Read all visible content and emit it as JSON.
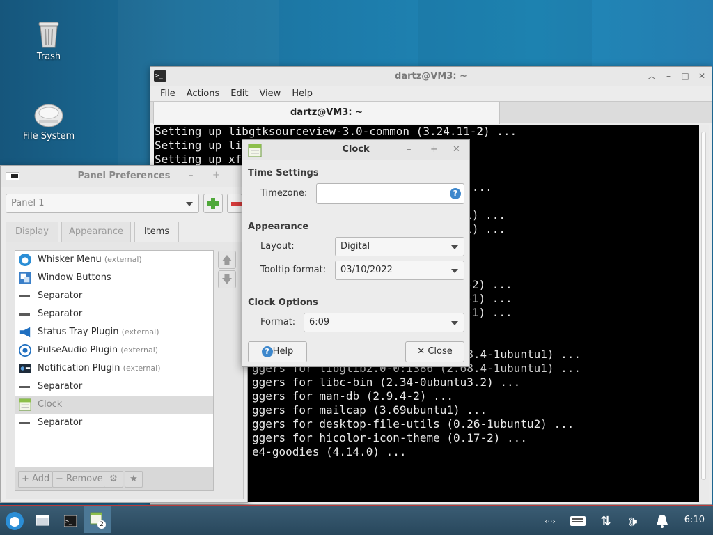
{
  "desktop": {
    "icons": [
      {
        "label": "Trash",
        "icon": "trash-icon"
      },
      {
        "label": "File System",
        "icon": "drive-icon"
      }
    ]
  },
  "terminal": {
    "title": "dartz@VM3: ~",
    "tab_title": "dartz@VM3: ~",
    "menu": [
      "File",
      "Actions",
      "Edit",
      "View",
      "Help"
    ],
    "lines": [
      "Setting up libgtksourceview-3.0-common (3.24.11-2) ...",
      "Setting up li",
      "Setting up xf",
      "",
      "              ...",
      "",
      "             1) ...",
      "             1) ...",
      "",
      "",
      "",
      "          .11-2) ...",
      "            0-1) ...",
      "            2-1) ...",
      "",
      "",
      "ggers for libglib2.0-0:i386 (2.68.4-1ubuntu1) ...",
      "ggers for libglib2.0-0:i386 (2.68.4-1ubuntu1) ...",
      "ggers for libc-bin (2.34-0ubuntu3.2) ...",
      "ggers for man-db (2.9.4-2) ...",
      "ggers for mailcap (3.69ubuntu1) ...",
      "ggers for desktop-file-utils (0.26-1ubuntu2) ...",
      "ggers for hicolor-icon-theme (0.17-2) ...",
      "e4-goodies (4.14.0) ..."
    ]
  },
  "prefs": {
    "title": "Panel Preferences",
    "panel_select": "Panel 1",
    "tabs": [
      "Display",
      "Appearance",
      "Items"
    ],
    "items": [
      {
        "name": "Whisker Menu",
        "ext": "(external)",
        "icon": "whisker-menu-icon"
      },
      {
        "name": "Window Buttons",
        "ext": "",
        "icon": "window-buttons-icon"
      },
      {
        "name": "Separator",
        "ext": "",
        "icon": "separator-icon"
      },
      {
        "name": "Separator",
        "ext": "",
        "icon": "separator-icon"
      },
      {
        "name": "Status Tray Plugin",
        "ext": "(external)",
        "icon": "megaphone-icon"
      },
      {
        "name": "PulseAudio Plugin",
        "ext": "(external)",
        "icon": "speaker-icon"
      },
      {
        "name": "Notification Plugin",
        "ext": "(external)",
        "icon": "notification-icon"
      },
      {
        "name": "Separator",
        "ext": "",
        "icon": "separator-icon"
      },
      {
        "name": "Clock",
        "ext": "",
        "icon": "clock-icon"
      },
      {
        "name": "Separator",
        "ext": "",
        "icon": "separator-icon"
      }
    ],
    "add_label": "Add",
    "remove_label": "Remove",
    "close_label": "Close"
  },
  "clock": {
    "title": "Clock",
    "time_settings": "Time Settings",
    "timezone_label": "Timezone:",
    "timezone_value": "",
    "appearance": "Appearance",
    "layout_label": "Layout:",
    "layout_value": "Digital",
    "tooltip_label": "Tooltip format:",
    "tooltip_value": "03/10/2022",
    "clock_options": "Clock Options",
    "format_label": "Format:",
    "format_value": "6:09",
    "help_label": "Help",
    "close_label": "Close"
  },
  "taskbar": {
    "workspace_badge": "2",
    "clock": "6:10"
  }
}
